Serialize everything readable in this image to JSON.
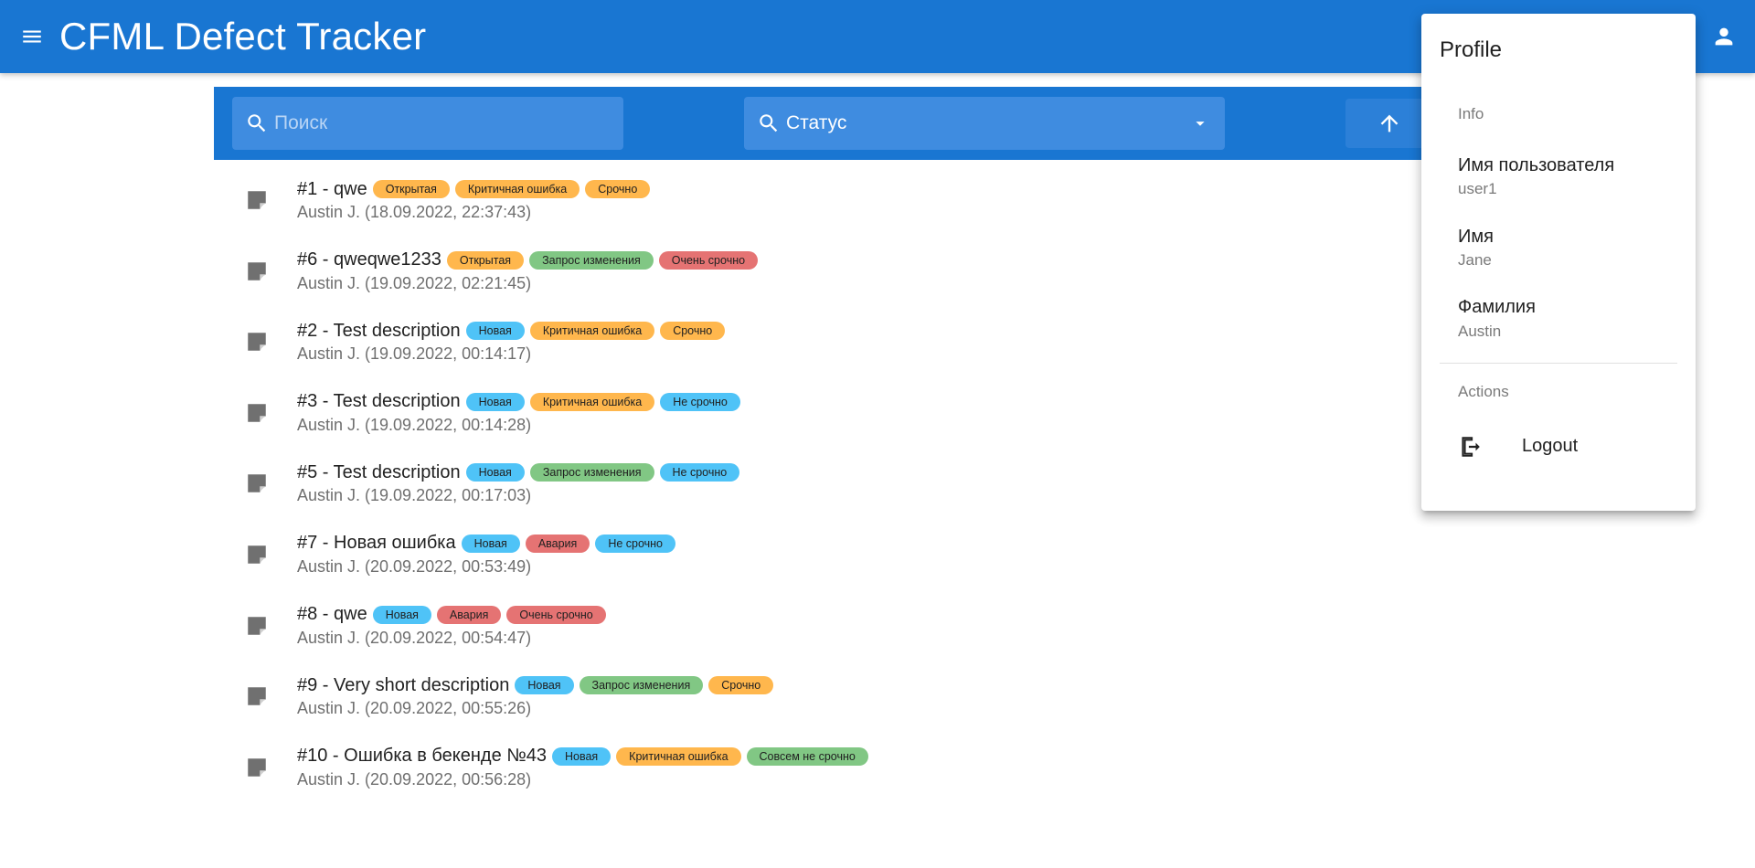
{
  "app": {
    "title": "CFML Defect Tracker"
  },
  "toolbar": {
    "search_placeholder": "Поиск",
    "status_label": "Статус"
  },
  "colors": {
    "primary": "#1976d2",
    "chip_blue": "#4fc3f7",
    "chip_orange": "#ffb74d",
    "chip_green": "#81c784",
    "chip_red": "#e57373"
  },
  "issues": [
    {
      "title": "#1 - qwe",
      "subtitle": "Austin J. (18.09.2022, 22:37:43)",
      "chips": [
        {
          "label": "Открытая",
          "color": "#ffb74d"
        },
        {
          "label": "Критичная ошибка",
          "color": "#ffb74d"
        },
        {
          "label": "Срочно",
          "color": "#ffb74d"
        }
      ]
    },
    {
      "title": "#6 - qweqwe1233",
      "subtitle": "Austin J. (19.09.2022, 02:21:45)",
      "chips": [
        {
          "label": "Открытая",
          "color": "#ffb74d"
        },
        {
          "label": "Запрос изменения",
          "color": "#81c784"
        },
        {
          "label": "Очень срочно",
          "color": "#e57373"
        }
      ]
    },
    {
      "title": "#2 - Test description",
      "subtitle": "Austin J. (19.09.2022, 00:14:17)",
      "chips": [
        {
          "label": "Новая",
          "color": "#4fc3f7"
        },
        {
          "label": "Критичная ошибка",
          "color": "#ffb74d"
        },
        {
          "label": "Срочно",
          "color": "#ffb74d"
        }
      ]
    },
    {
      "title": "#3 - Test description",
      "subtitle": "Austin J. (19.09.2022, 00:14:28)",
      "chips": [
        {
          "label": "Новая",
          "color": "#4fc3f7"
        },
        {
          "label": "Критичная ошибка",
          "color": "#ffb74d"
        },
        {
          "label": "Не срочно",
          "color": "#4fc3f7"
        }
      ]
    },
    {
      "title": "#5 - Test description",
      "subtitle": "Austin J. (19.09.2022, 00:17:03)",
      "chips": [
        {
          "label": "Новая",
          "color": "#4fc3f7"
        },
        {
          "label": "Запрос изменения",
          "color": "#81c784"
        },
        {
          "label": "Не срочно",
          "color": "#4fc3f7"
        }
      ]
    },
    {
      "title": "#7 - Новая ошибка",
      "subtitle": "Austin J. (20.09.2022, 00:53:49)",
      "chips": [
        {
          "label": "Новая",
          "color": "#4fc3f7"
        },
        {
          "label": "Авария",
          "color": "#e57373"
        },
        {
          "label": "Не срочно",
          "color": "#4fc3f7"
        }
      ]
    },
    {
      "title": "#8 - qwe",
      "subtitle": "Austin J. (20.09.2022, 00:54:47)",
      "chips": [
        {
          "label": "Новая",
          "color": "#4fc3f7"
        },
        {
          "label": "Авария",
          "color": "#e57373"
        },
        {
          "label": "Очень срочно",
          "color": "#e57373"
        }
      ]
    },
    {
      "title": "#9 - Very short description",
      "subtitle": "Austin J. (20.09.2022, 00:55:26)",
      "chips": [
        {
          "label": "Новая",
          "color": "#4fc3f7"
        },
        {
          "label": "Запрос изменения",
          "color": "#81c784"
        },
        {
          "label": "Срочно",
          "color": "#ffb74d"
        }
      ]
    },
    {
      "title": "#10 - Ошибка в бекенде №43",
      "subtitle": "Austin J. (20.09.2022, 00:56:28)",
      "chips": [
        {
          "label": "Новая",
          "color": "#4fc3f7"
        },
        {
          "label": "Критичная ошибка",
          "color": "#ffb74d"
        },
        {
          "label": "Совсем не срочно",
          "color": "#81c784"
        }
      ]
    }
  ],
  "profile_menu": {
    "title": "Profile",
    "info_header": "Info",
    "username_label": "Имя пользователя",
    "username_value": "user1",
    "first_name_label": "Имя",
    "first_name_value": "Jane",
    "last_name_label": "Фамилия",
    "last_name_value": "Austin",
    "actions_header": "Actions",
    "logout_label": "Logout"
  }
}
